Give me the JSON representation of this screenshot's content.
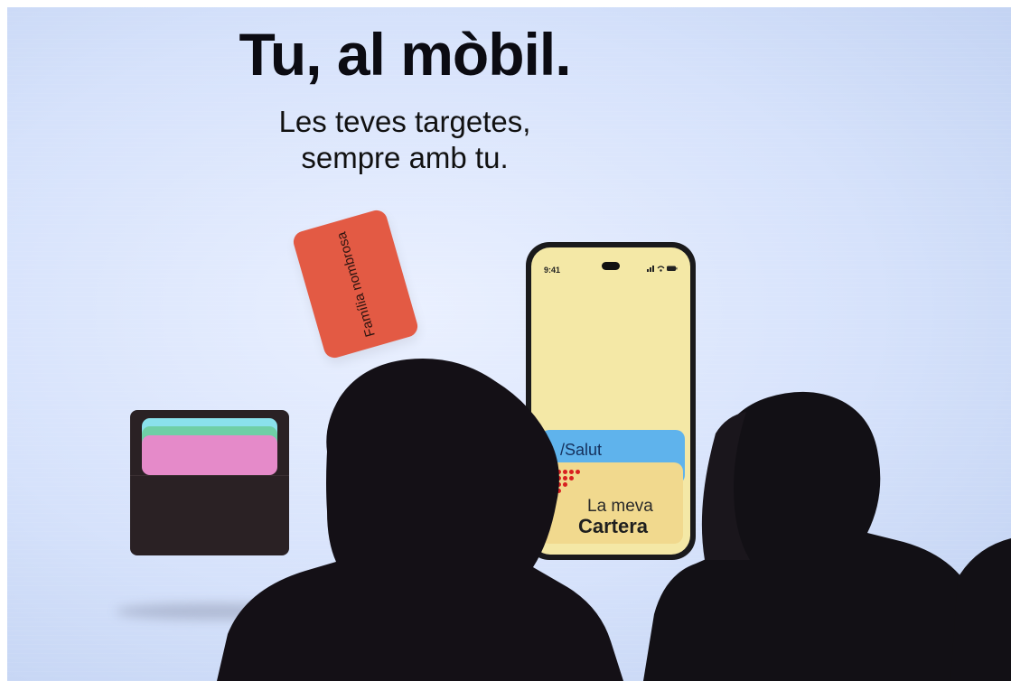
{
  "headline": "Tu, al mòbil.",
  "subheadline_line1": "Les teves targetes,",
  "subheadline_line2": "sempre amb tu.",
  "family_card": {
    "label": "Família nombrosa",
    "color": "#e35a44"
  },
  "wallet": {
    "card_colors": [
      "#8ae1ec",
      "#6fcfa6",
      "#e58ac9"
    ],
    "color": "#2a2124"
  },
  "phone": {
    "time": "9:41",
    "status_icons": "signal-icon wifi-icon battery-icon",
    "screen_color": "#f4e8a6",
    "salut_card": {
      "label": "/Salut",
      "color": "#5fb3ec"
    },
    "cartera_card": {
      "line1": "La meva",
      "line2": "Cartera",
      "color": "#f1d98e"
    }
  }
}
